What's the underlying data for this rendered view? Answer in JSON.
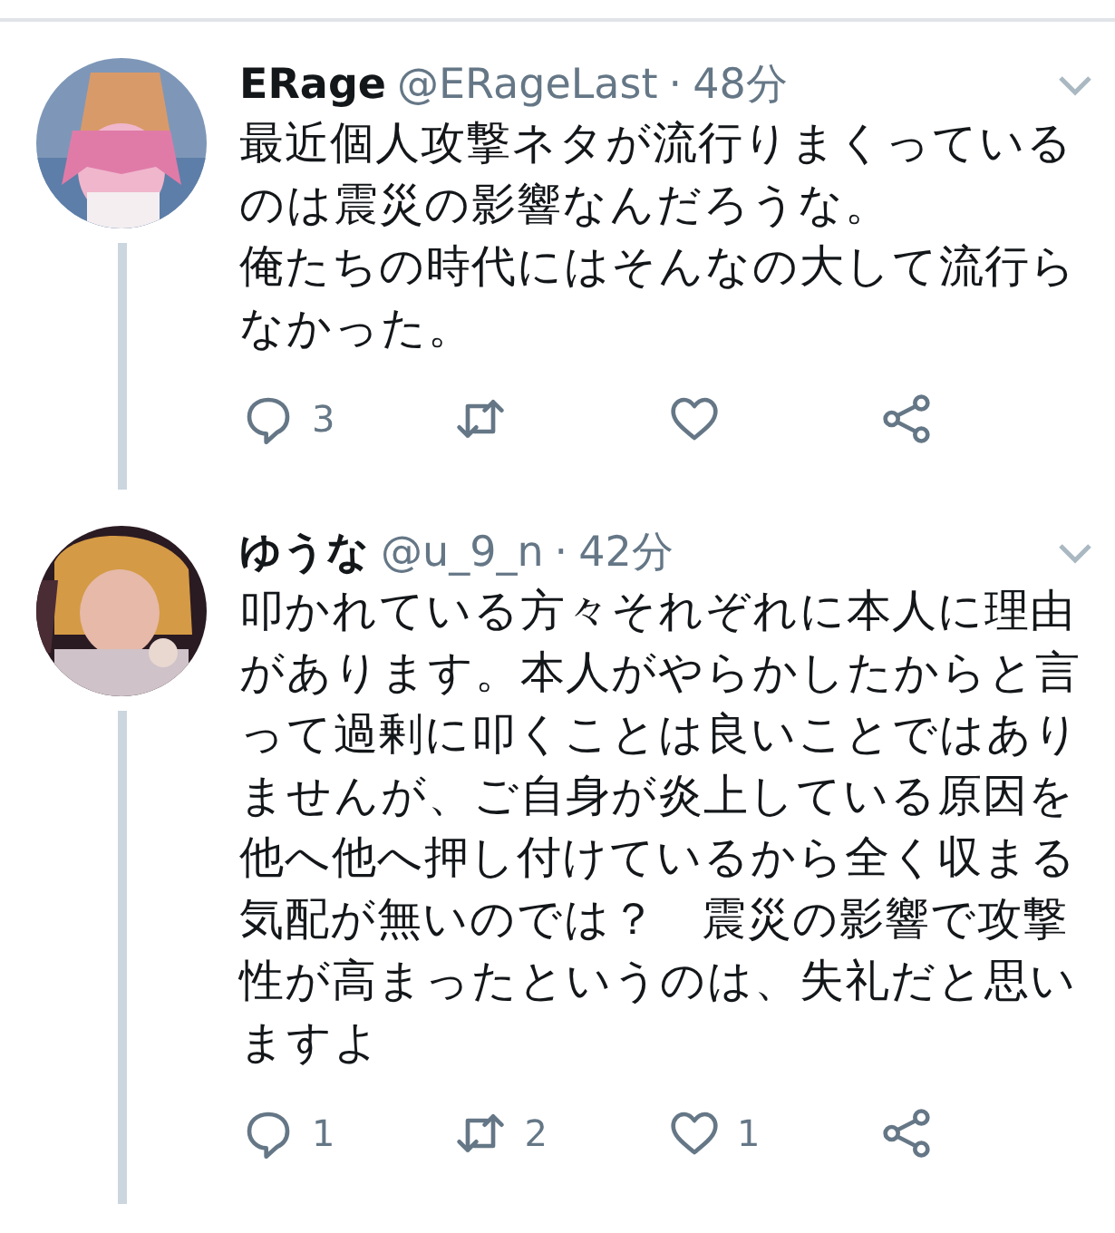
{
  "tweets": [
    {
      "name": "ERage",
      "handle": "@ERageLast",
      "sep": "·",
      "time": "48分",
      "paragraphs": [
        "最近個人攻撃ネタが流行りまくっているのは震災の影響なんだろうな。",
        "俺たちの時代にはそんなの大して流行らなかった。"
      ],
      "actions": [
        {
          "kind": "reply",
          "count": "3"
        },
        {
          "kind": "retweet"
        },
        {
          "kind": "like"
        },
        {
          "kind": "share"
        }
      ]
    },
    {
      "name": "ゆうな",
      "handle": "@u_9_n",
      "sep": "·",
      "time": "42分",
      "paragraphs": [
        "叩かれている方々それぞれに本人に理由があります。本人がやらかしたからと言って過剰に叩くことは良いことではありませんが、ご自身が炎上している原因を他へ他へ押し付けているから全く収まる気配が無いのでは？　震災の影響で攻撃性が高まったというのは、失礼だと思いますよ"
      ],
      "actions": [
        {
          "kind": "reply",
          "count": "1"
        },
        {
          "kind": "retweet",
          "count": "2"
        },
        {
          "kind": "like",
          "count": "1"
        },
        {
          "kind": "share"
        }
      ]
    }
  ]
}
